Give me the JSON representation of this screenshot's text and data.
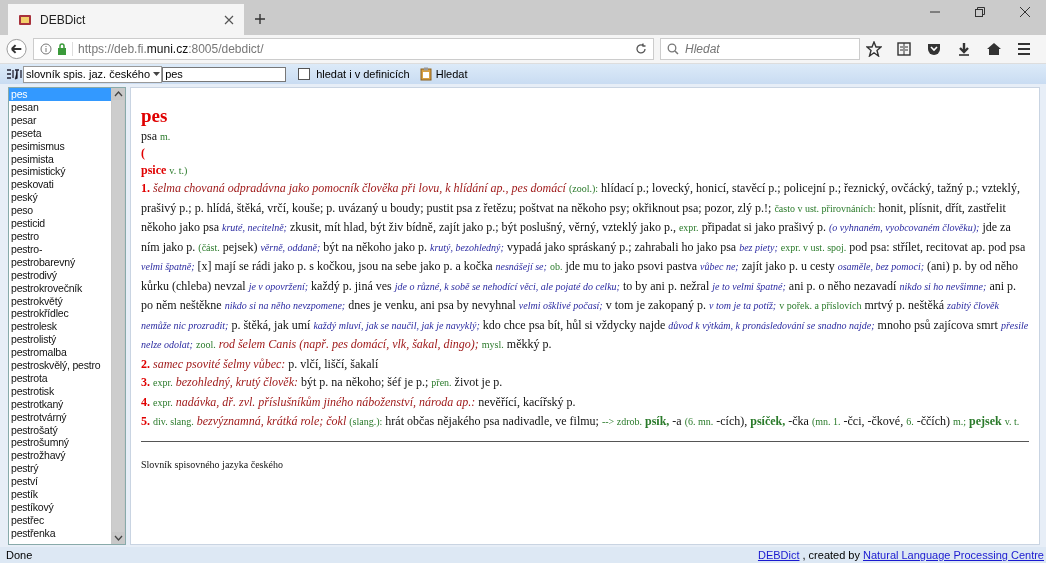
{
  "browser": {
    "tab_title": "DEBDict",
    "url_prefix": "https://deb.fi.",
    "url_domain": "muni.cz",
    "url_suffix": ":8005/debdict/",
    "search_placeholder": "Hledat"
  },
  "toolbar": {
    "dictionary": "slovník spis. jaz. českého",
    "query": "pes",
    "definitions_checkbox": {
      "label": "hledat i v definicích",
      "checked": false
    },
    "search_button": "Hledat"
  },
  "word_list": [
    {
      "text": "pes",
      "selected": true
    },
    {
      "text": "pesan",
      "selected": false
    },
    {
      "text": "pesar",
      "selected": false
    },
    {
      "text": "peseta",
      "selected": false
    },
    {
      "text": "pesimismus",
      "selected": false
    },
    {
      "text": "pesimista",
      "selected": false
    },
    {
      "text": "pesimistický",
      "selected": false
    },
    {
      "text": "peskovati",
      "selected": false
    },
    {
      "text": "peský",
      "selected": false
    },
    {
      "text": "peso",
      "selected": false
    },
    {
      "text": "pesticid",
      "selected": false
    },
    {
      "text": "pestro",
      "selected": false
    },
    {
      "text": "pestro-",
      "selected": false
    },
    {
      "text": "pestrobarevný",
      "selected": false
    },
    {
      "text": "pestrodivý",
      "selected": false
    },
    {
      "text": "pestrokrovečník",
      "selected": false
    },
    {
      "text": "pestrokvětý",
      "selected": false
    },
    {
      "text": "pestrokřídlec",
      "selected": false
    },
    {
      "text": "pestrolesk",
      "selected": false
    },
    {
      "text": "pestrolistý",
      "selected": false
    },
    {
      "text": "pestromalba",
      "selected": false
    },
    {
      "text": "pestroskvělý, pestro",
      "selected": false
    },
    {
      "text": "pestrota",
      "selected": false
    },
    {
      "text": "pestrotisk",
      "selected": false
    },
    {
      "text": "pestrotkaný",
      "selected": false
    },
    {
      "text": "pestrotvárný",
      "selected": false
    },
    {
      "text": "pestrošatý",
      "selected": false
    },
    {
      "text": "pestrošumný",
      "selected": false
    },
    {
      "text": "pestrožhavý",
      "selected": false
    },
    {
      "text": "pestrý",
      "selected": false
    },
    {
      "text": "peství",
      "selected": false
    },
    {
      "text": "pestík",
      "selected": false
    },
    {
      "text": "pestíkový",
      "selected": false
    },
    {
      "text": "pestřec",
      "selected": false
    },
    {
      "text": "pestřenka",
      "selected": false
    }
  ],
  "entry": {
    "headword": "pes",
    "lines": [
      {
        "segments": [
          {
            "kind": "plain",
            "text": "psa"
          },
          {
            "kind": "gram",
            "text": "m."
          }
        ]
      },
      {
        "segments": [
          {
            "kind": "paren",
            "text": "("
          }
        ]
      },
      {
        "segments": [
          {
            "kind": "form",
            "text": "psice"
          },
          {
            "kind": "gram",
            "text": "v. t.)"
          }
        ]
      }
    ],
    "senses": [
      {
        "number": "1.",
        "segments": [
          {
            "kind": "def",
            "text": "šelma chovaná odpradávna jako pomocník člověka při lovu, k hlídání ap., pes domácí"
          },
          {
            "kind": "gram",
            "text": "(zool.):"
          },
          {
            "kind": "plain",
            "text": "hlídací p.; lovecký, honicí, stavěcí p.; policejní p.; řeznický, ovčácký, tažný p.; vzteklý, prašivý p.; p. hlídá, štěká, vrčí, kouše; p. uvázaný u boudy; pustit psa z řetězu; poštvat na někoho psy; okřiknout psa; pozor, zlý p.!;"
          },
          {
            "kind": "gram",
            "text": "často v ust. přirovnáních:"
          },
          {
            "kind": "plain",
            "text": "honit, plísnit, dřít, zastřelit někoho jako psa"
          },
          {
            "kind": "note",
            "text": "kruté, necitelně;"
          },
          {
            "kind": "plain",
            "text": "zkusit, mít hlad, být živ bídně, zajít jako p.; být poslušný, věrný, vzteklý jako p.,"
          },
          {
            "kind": "gram",
            "text": "expr."
          },
          {
            "kind": "plain",
            "text": "připadat si jako prašivý p."
          },
          {
            "kind": "note",
            "text": "(o vyhnaném, vyobcovaném člověku);"
          },
          {
            "kind": "plain",
            "text": "jde za ním jako p."
          },
          {
            "kind": "gram",
            "text": "(část."
          },
          {
            "kind": "plain",
            "text": "pejsek)"
          },
          {
            "kind": "note",
            "text": "věrně, oddaně;"
          },
          {
            "kind": "plain",
            "text": "být na někoho jako p."
          },
          {
            "kind": "note",
            "text": "krutý, bezohledný;"
          },
          {
            "kind": "plain",
            "text": "vypadá jako spráskaný p.; zahrabali ho jako psa"
          },
          {
            "kind": "note",
            "text": "bez piety;"
          },
          {
            "kind": "gram",
            "text": "expr. v ust. spoj."
          },
          {
            "kind": "plain",
            "text": "pod psa: střílet, recitovat ap. pod psa"
          },
          {
            "kind": "note",
            "text": "velmi špatně;"
          },
          {
            "kind": "plain",
            "text": "[x] mají se rádi jako p. s kočkou, jsou na sebe jako p. a kočka"
          },
          {
            "kind": "note",
            "text": "nesnášejí se;"
          },
          {
            "kind": "gram",
            "text": "ob."
          },
          {
            "kind": "plain",
            "text": "jde mu to jako psovi pastva"
          },
          {
            "kind": "note",
            "text": "vůbec ne;"
          },
          {
            "kind": "plain",
            "text": "zajít jako p. u cesty"
          },
          {
            "kind": "note",
            "text": "osaměle, bez pomoci;"
          },
          {
            "kind": "plain",
            "text": "(ani) p. by od něho kůrku (chleba) nevzal"
          },
          {
            "kind": "note",
            "text": "je v opovržení;"
          },
          {
            "kind": "plain",
            "text": "každý p. jiná ves"
          },
          {
            "kind": "note",
            "text": "jde o různé, k sobě se nehodící věci, ale pojaté do celku;"
          },
          {
            "kind": "plain",
            "text": "to by ani p. nežral"
          },
          {
            "kind": "note",
            "text": "je to velmi špatné;"
          },
          {
            "kind": "plain",
            "text": "ani p. o něho nezavadí"
          },
          {
            "kind": "note",
            "text": "nikdo si ho nevšimne;"
          },
          {
            "kind": "plain",
            "text": "ani p. po něm neštěkne"
          },
          {
            "kind": "note",
            "text": "nikdo si na něho nevzpomene;"
          },
          {
            "kind": "plain",
            "text": "dnes je venku, ani psa by nevyhnal"
          },
          {
            "kind": "note",
            "text": "velmi ošklivé počasí;"
          },
          {
            "kind": "plain",
            "text": "v tom je zakopaný p."
          },
          {
            "kind": "note",
            "text": "v tom je ta potíž;"
          },
          {
            "kind": "gram",
            "text": "v pořek. a příslovích"
          },
          {
            "kind": "plain",
            "text": "mrtvý p. neštěká"
          },
          {
            "kind": "note",
            "text": "zabitý člověk nemůže nic prozradit;"
          },
          {
            "kind": "plain",
            "text": "p. štěká, jak umí"
          },
          {
            "kind": "note",
            "text": "každý mluví, jak se naučil, jak je navyklý;"
          },
          {
            "kind": "plain",
            "text": "kdo chce psa bít, hůl si vždycky najde"
          },
          {
            "kind": "note",
            "text": "důvod k výtkám, k pronásledování se snadno najde;"
          },
          {
            "kind": "plain",
            "text": "mnoho psů zajícova smrt"
          },
          {
            "kind": "note",
            "text": "přesile nelze odolat;"
          },
          {
            "kind": "gram",
            "text": "zool."
          },
          {
            "kind": "def",
            "text": "rod šelem Canis (např. pes domácí, vlk, šakal, dingo);"
          },
          {
            "kind": "gram",
            "text": "mysl."
          },
          {
            "kind": "plain",
            "text": "měkký p."
          }
        ]
      },
      {
        "number": "2.",
        "segments": [
          {
            "kind": "def",
            "text": "samec psovité šelmy vůbec:"
          },
          {
            "kind": "plain",
            "text": "p. vlčí, liščí, šakalí"
          }
        ]
      },
      {
        "number": "3.",
        "segments": [
          {
            "kind": "gram",
            "text": "expr."
          },
          {
            "kind": "def",
            "text": "bezohledný, krutý člověk:"
          },
          {
            "kind": "plain",
            "text": "být p. na někoho; šéf je p.;"
          },
          {
            "kind": "gram",
            "text": "přen."
          },
          {
            "kind": "plain",
            "text": "život je p."
          }
        ]
      },
      {
        "number": "4.",
        "segments": [
          {
            "kind": "gram",
            "text": "expr."
          },
          {
            "kind": "def",
            "text": "nadávka, dř. zvl. příslušníkům jiného náboženství, národa ap.:"
          },
          {
            "kind": "plain",
            "text": "nevěřící, kacířský p."
          }
        ]
      },
      {
        "number": "5.",
        "segments": [
          {
            "kind": "gram",
            "text": "div. slang."
          },
          {
            "kind": "def",
            "text": "bezvýznamná, krátká role; čokl"
          },
          {
            "kind": "gram",
            "text": "(slang.):"
          },
          {
            "kind": "plain",
            "text": "hrát občas nějakého psa nadivadle, ve filmu;"
          },
          {
            "kind": "gram",
            "text": "--> zdrob."
          },
          {
            "kind": "head",
            "text": "psík,"
          },
          {
            "kind": "plain",
            "text": "-a"
          },
          {
            "kind": "gram",
            "text": "(6. mn."
          },
          {
            "kind": "plain",
            "text": "-cích),"
          },
          {
            "kind": "head",
            "text": "psíček,"
          },
          {
            "kind": "plain",
            "text": "-čka"
          },
          {
            "kind": "gram",
            "text": "(mn. 1."
          },
          {
            "kind": "plain",
            "text": "-čci, -čkové,"
          },
          {
            "kind": "gram",
            "text": "6."
          },
          {
            "kind": "plain",
            "text": "-ččích)"
          },
          {
            "kind": "gram",
            "text": "m.;"
          },
          {
            "kind": "head",
            "text": "pejsek"
          },
          {
            "kind": "gram",
            "text": "v. t."
          }
        ]
      }
    ],
    "source": "Slovník spisovného jazyka českého"
  },
  "status_bar": {
    "status": "Done",
    "credit_link": "DEBDict",
    "credit_text": ", created by",
    "credit_org": "Natural Language Processing Centre"
  }
}
